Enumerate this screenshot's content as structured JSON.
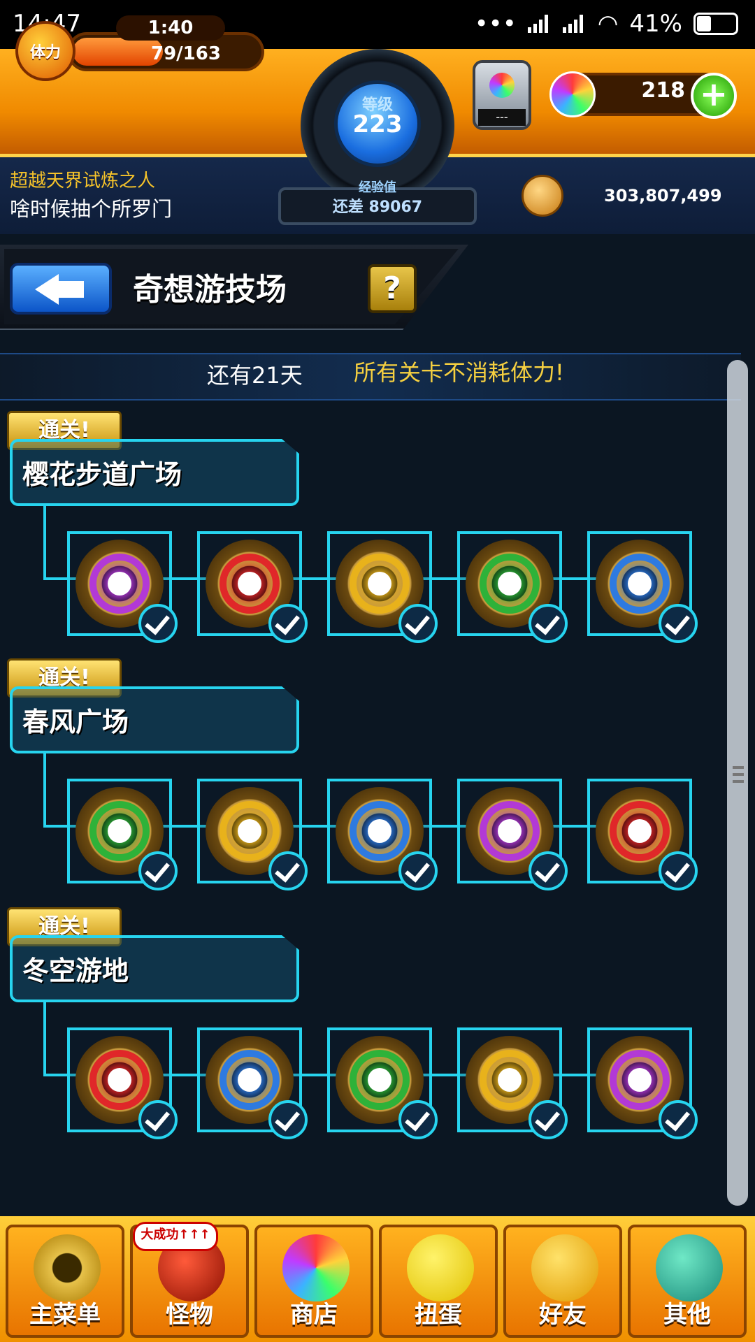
{
  "status_bar": {
    "time": "14:47",
    "battery": "41%",
    "battery_level": 0.41
  },
  "hud": {
    "stamina_label": "体力",
    "stamina_timer": "1:40",
    "stamina_value": "79/163",
    "stamina_fraction": 0.485,
    "level_label": "等级",
    "level_value": "223",
    "exp_label": "经验值",
    "exp_value": "还差 89067",
    "machine_label": "---",
    "gem_count": "218",
    "gem_add": "+",
    "coin_value": "303,807,499"
  },
  "player": {
    "title": "超越天界试炼之人",
    "name": "啥时候抽个所罗门"
  },
  "header": {
    "title": "奇想游技场",
    "help": "?"
  },
  "notice": {
    "days_left": "还有21天",
    "text": "所有关卡不消耗体力!"
  },
  "areas": [
    {
      "badge": "通关!",
      "name": "樱花步道广场",
      "stages": [
        "purple",
        "red",
        "yellow",
        "green",
        "blue"
      ]
    },
    {
      "badge": "通关!",
      "name": "春风广场",
      "stages": [
        "green",
        "yellow",
        "blue",
        "purple",
        "red"
      ]
    },
    {
      "badge": "通关!",
      "name": "冬空游地",
      "stages": [
        "red",
        "blue",
        "green",
        "yellow",
        "purple"
      ]
    }
  ],
  "element_colors": {
    "purple": "#b23ad6",
    "red": "#e0282a",
    "yellow": "#e8b21c",
    "green": "#2fb23a",
    "blue": "#2f7be0"
  },
  "nav": {
    "badge": "大成功↑↑↑",
    "tabs": [
      {
        "label": "主菜单",
        "icon": "gate-icon"
      },
      {
        "label": "怪物",
        "icon": "monster-icon"
      },
      {
        "label": "商店",
        "icon": "rainbow-orb-icon"
      },
      {
        "label": "扭蛋",
        "icon": "egg-icon"
      },
      {
        "label": "好友",
        "icon": "friends-icon"
      },
      {
        "label": "其他",
        "icon": "question-icon"
      }
    ]
  }
}
